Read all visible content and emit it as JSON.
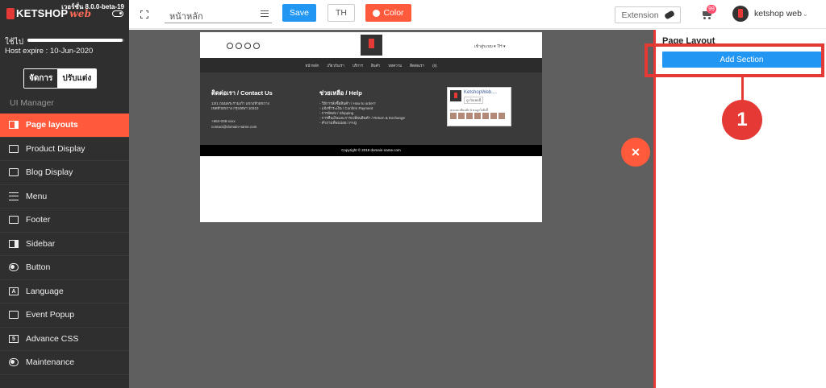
{
  "app": {
    "version": "เวอร์ชั่น 8.0.0-beta-19",
    "logo_text": "KETSHOP",
    "logo_suffix": "web"
  },
  "sidebar": {
    "usage_label": "ใช้ไป",
    "usage_fraction": 0.98,
    "host_expire": "Host expire : 10-Jun-2020",
    "mode_manage": "จัดการ",
    "mode_customize": "ปรับแต่ง",
    "section_title": "UI Manager",
    "items": [
      {
        "label": "Page layouts",
        "icon": "page-layout-icon",
        "active": true
      },
      {
        "label": "Product Display",
        "icon": "product-display-icon"
      },
      {
        "label": "Blog Display",
        "icon": "blog-display-icon"
      },
      {
        "label": "Menu",
        "icon": "menu-icon"
      },
      {
        "label": "Footer",
        "icon": "footer-icon"
      },
      {
        "label": "Sidebar",
        "icon": "sidebar-icon"
      },
      {
        "label": "Button",
        "icon": "toggle-icon"
      },
      {
        "label": "Language",
        "icon": "language-icon"
      },
      {
        "label": "Event Popup",
        "icon": "popup-icon"
      },
      {
        "label": "Advance CSS",
        "icon": "css-icon"
      },
      {
        "label": "Maintenance",
        "icon": "bug-icon"
      }
    ]
  },
  "topbar": {
    "page_select": "หน้าหลัก",
    "save": "Save",
    "lang": "TH",
    "color": "Color",
    "extension": "Extension",
    "cart_count": "99",
    "user": "ketshop web"
  },
  "preview": {
    "login": "เข้าสู่ระบบ ▾   TH ▾",
    "nav": [
      "หน้าหลัก",
      "เกี่ยวกับเรา",
      "บริการ",
      "สินค้า",
      "บทความ",
      "ติดต่อเรา",
      "(0)"
    ],
    "contact_title": "ติดต่อเรา / Contact Us",
    "contact_address": "12/1 ถนนพระรามเก้า แขวงห้วยขวาง เขตห้วยขวาง กรุงเทพฯ 10310",
    "contact_phone": "+662-038-xxxx",
    "contact_email": "contact@domain-name.com",
    "help_title": "ช่วยเหลือ / Help",
    "help_links": "- วิธีการสั่งซื้อสินค้า / How to order?\n- แจ้งชำระเงิน / Confirm Payment\n- การจัดส่ง / Shipping\n- การคืนเงินและการเปลี่ยนสินค้า / Return & Exchange\n- คำถามที่พบบ่อย / FAQ",
    "fb_name": "KetshopWeb....",
    "fb_like": "ถูกใจเพจนี้",
    "fb_text": "คุณและเพื่อนอีก 8 คนถูกใจสิ่งนี้",
    "copyright": "Copyright © 2019 domain-name.com"
  },
  "panel": {
    "title": "Page Layout",
    "add_section": "Add Section",
    "step_number": "1"
  },
  "colors": {
    "accent": "#ff5a3c",
    "primary": "#2196f3",
    "highlight": "#e53935",
    "sidebar_bg": "#2f2f2f"
  }
}
